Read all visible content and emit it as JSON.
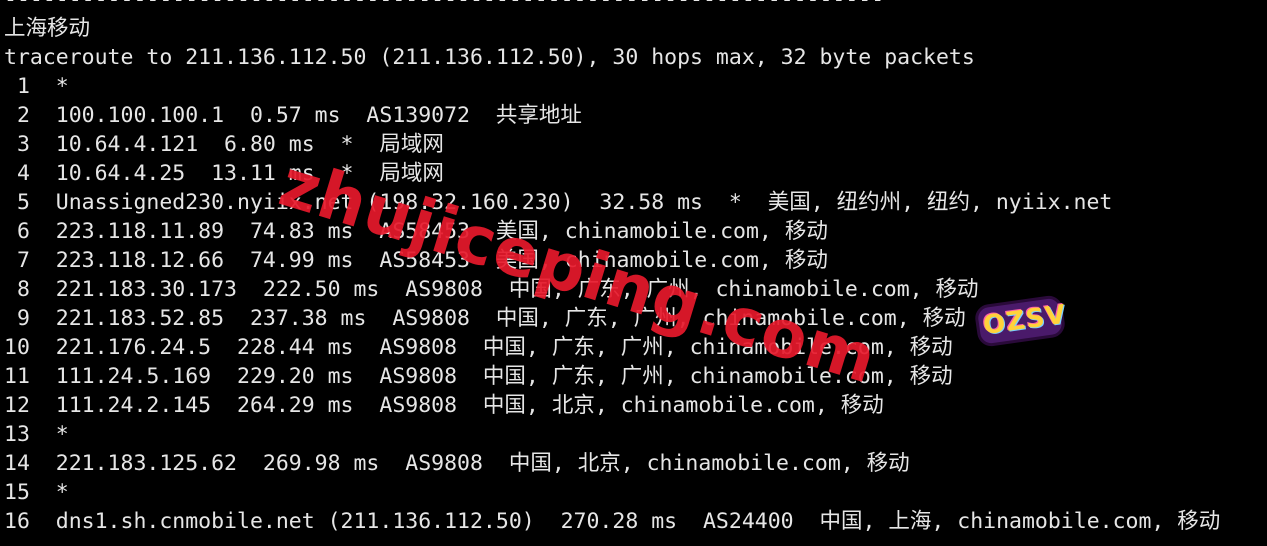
{
  "terminal": {
    "lines": [
      "--------------------------------------------------------------------",
      "上海移动",
      "traceroute to 211.136.112.50 (211.136.112.50), 30 hops max, 32 byte packets",
      " 1  *",
      " 2  100.100.100.1  0.57 ms  AS139072  共享地址",
      " 3  10.64.4.121  6.80 ms  *  局域网",
      " 4  10.64.4.25  13.11 ms  *  局域网",
      " 5  Unassigned230.nyiix.net (198.32.160.230)  32.58 ms  *  美国, 纽约州, 纽约, nyiix.net",
      " 6  223.118.11.89  74.83 ms  AS58453  美国, chinamobile.com, 移动",
      " 7  223.118.12.66  74.99 ms  AS58453  美国, chinamobile.com, 移动",
      " 8  221.183.30.173  222.50 ms  AS9808  中国, 广东, 广州, chinamobile.com, 移动",
      " 9  221.183.52.85  237.38 ms  AS9808  中国, 广东, 广州, chinamobile.com, 移动",
      "10  221.176.24.5  228.44 ms  AS9808  中国, 广东, 广州, chinamobile.com, 移动",
      "11  111.24.5.169  229.20 ms  AS9808  中国, 广东, 广州, chinamobile.com, 移动",
      "12  111.24.2.145  264.29 ms  AS9808  中国, 北京, chinamobile.com, 移动",
      "13  *",
      "14  221.183.125.62  269.98 ms  AS9808  中国, 北京, chinamobile.com, 移动",
      "15  *",
      "16  dns1.sh.cnmobile.net (211.136.112.50)  270.28 ms  AS24400  中国, 上海, chinamobile.com, 移动"
    ]
  },
  "watermark": {
    "text": "zhujiceping.com",
    "color": "#e8192c"
  },
  "sticker": {
    "text": "OZSV"
  },
  "colors": {
    "background": "#000000",
    "foreground": "#e6e6e6"
  }
}
